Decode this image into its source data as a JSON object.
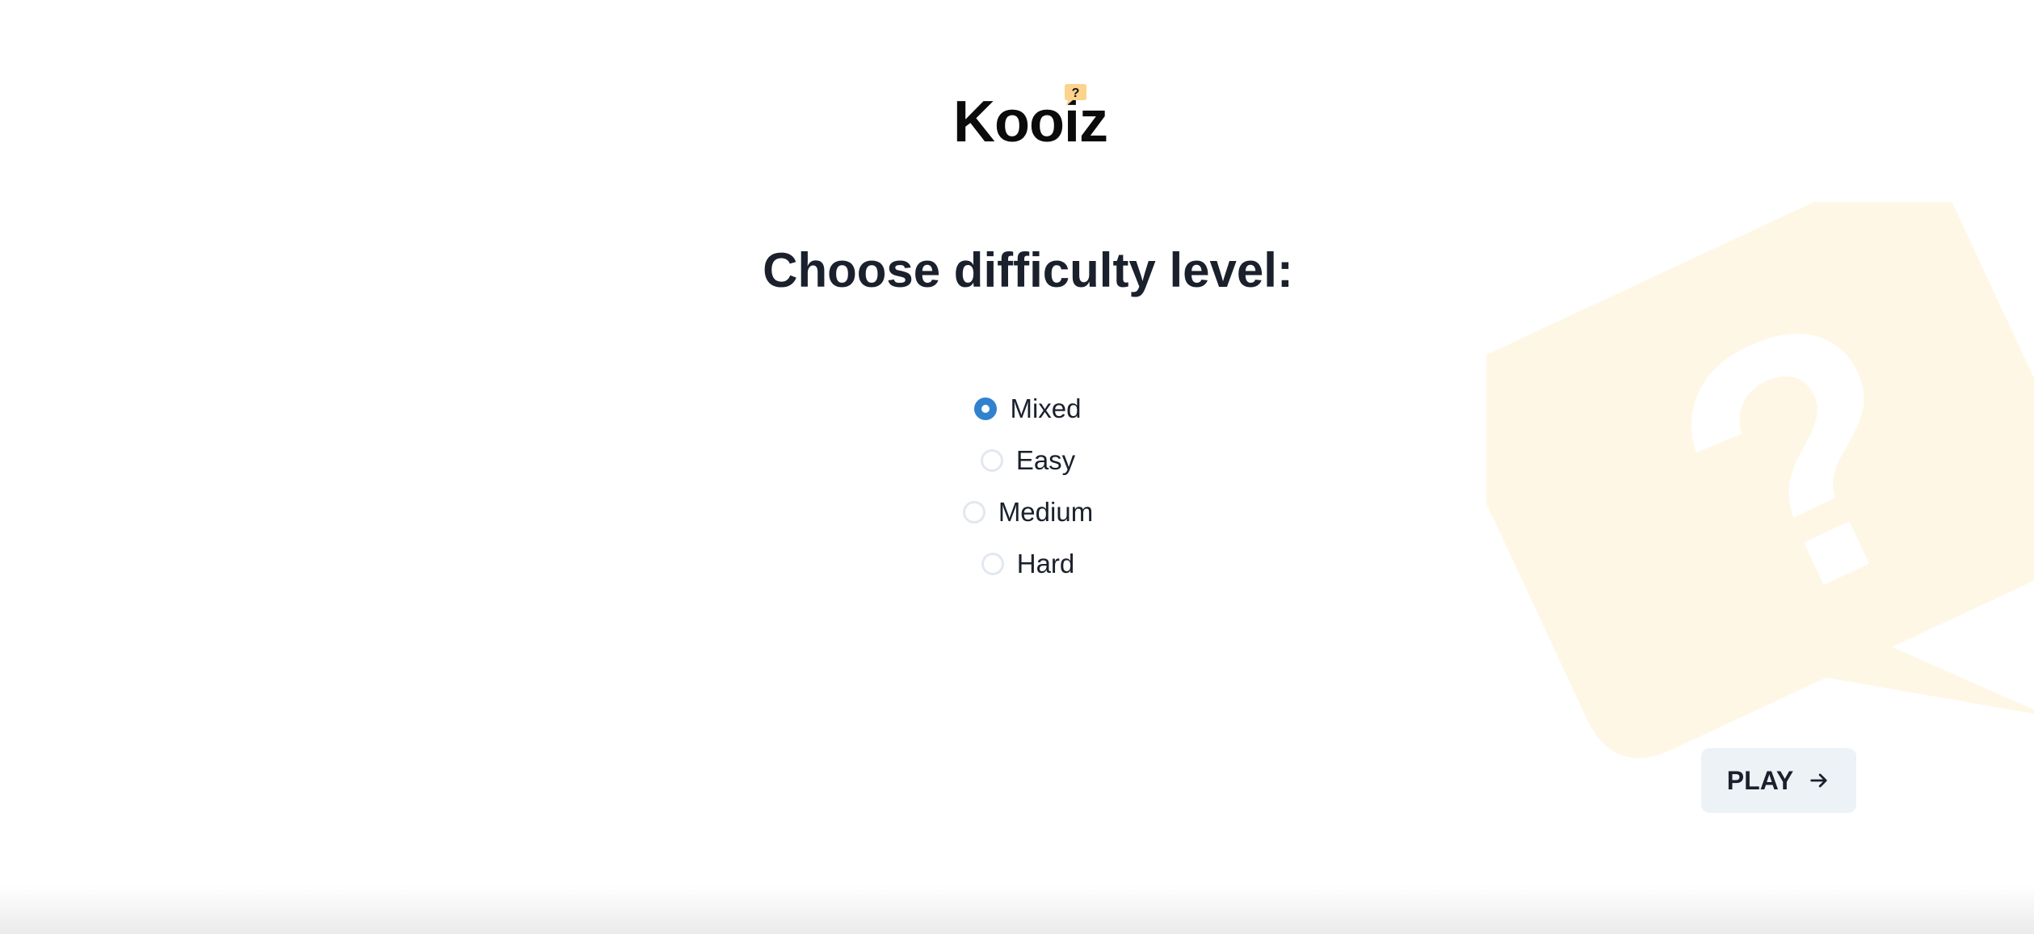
{
  "app": {
    "logo_text": "Kooiz",
    "logo_badge": "?"
  },
  "page": {
    "heading": "Choose difficulty level:"
  },
  "difficulty": {
    "selected": "Mixed",
    "options": [
      {
        "label": "Mixed",
        "checked": true
      },
      {
        "label": "Easy",
        "checked": false
      },
      {
        "label": "Medium",
        "checked": false
      },
      {
        "label": "Hard",
        "checked": false
      }
    ]
  },
  "actions": {
    "play_label": "PLAY",
    "play_icon": "arrow-right-icon"
  },
  "colors": {
    "accent": "#3182ce",
    "text": "#1a202c",
    "button_bg": "#edf2f7",
    "bubble": "#fff7e6",
    "badge": "#fbd38d"
  },
  "decor": {
    "background_icon": "question-bubble-icon"
  }
}
